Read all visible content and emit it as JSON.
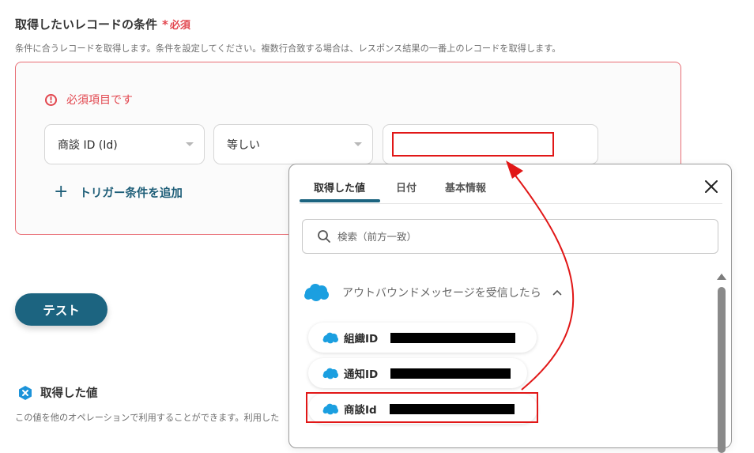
{
  "section": {
    "title": "取得したいレコードの条件",
    "required_mark": "*",
    "required_label": "必須",
    "description": "条件に合うレコードを取得します。条件を設定してください。複数行合致する場合は、レスポンス結果の一番上のレコードを取得します。"
  },
  "condition": {
    "warning_text": "必須項目です",
    "field_select": "商談 ID (Id)",
    "operator_select": "等しい",
    "value_input": "",
    "add_trigger_label": "トリガー条件を追加"
  },
  "test_button_label": "テスト",
  "acquired": {
    "title": "取得した値",
    "description": "この値を他のオペレーションで利用することができます。利用した"
  },
  "popup": {
    "tabs": [
      "取得した値",
      "日付",
      "基本情報"
    ],
    "search_placeholder": "検索（前方一致）",
    "group_title": "アウトバウンドメッセージを受信したら",
    "items": [
      {
        "label": "組織ID"
      },
      {
        "label": "通知ID"
      },
      {
        "label": "商談Id"
      }
    ]
  },
  "colors": {
    "accent": "#1c6480",
    "error": "#e2464e",
    "highlight": "#e11717",
    "salesforce": "#1b9fe0"
  }
}
